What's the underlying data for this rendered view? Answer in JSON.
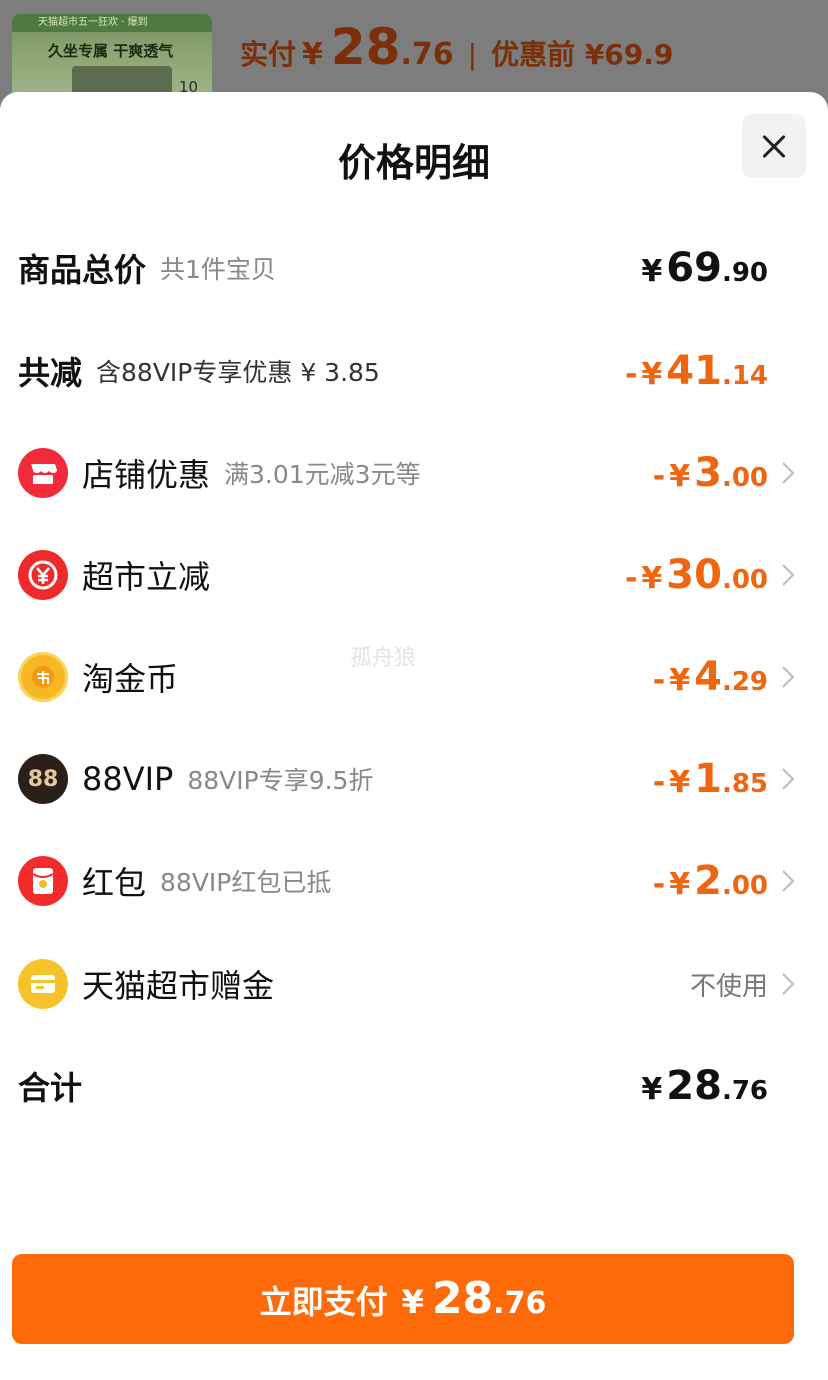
{
  "background": {
    "thumb_strip": "天猫超市五一狂欢 · 爆到",
    "thumb_title": "久坐专属  干爽透气",
    "thumb_number": "10",
    "paid_label": "实付",
    "paid_yen": "¥",
    "paid_int": "28",
    "paid_dec": ".76",
    "separator": "|",
    "before_discount": "优惠前 ¥69.9"
  },
  "sheet": {
    "title": "价格明细",
    "close_icon": "close-icon"
  },
  "rows": {
    "total_goods": {
      "label": "商品总价",
      "sub": "共1件宝贝",
      "yen": "¥",
      "int": "69",
      "dec": ".90"
    },
    "total_reduction": {
      "label": "共减",
      "sub": "含88VIP专享优惠 ¥ 3.85",
      "prefix": "-",
      "yen": "¥",
      "int": "41",
      "dec": ".14"
    },
    "store_discount": {
      "icon": "store-icon",
      "label": "店铺优惠",
      "sub": "满3.01元减3元等",
      "prefix": "-",
      "yen": "¥",
      "int": "3",
      "dec": ".00"
    },
    "supermarket_cut": {
      "icon": "yuan-coin-icon",
      "label": "超市立减",
      "sub": "",
      "prefix": "-",
      "yen": "¥",
      "int": "30",
      "dec": ".00"
    },
    "tao_coin": {
      "icon": "tao-coin-icon",
      "label": "淘金币",
      "sub": "",
      "prefix": "-",
      "yen": "¥",
      "int": "4",
      "dec": ".29"
    },
    "vip88": {
      "icon": "88vip-icon",
      "icon_text": "88",
      "label": "88VIP",
      "sub": "88VIP专享9.5折",
      "prefix": "-",
      "yen": "¥",
      "int": "1",
      "dec": ".85"
    },
    "red_packet": {
      "icon": "red-packet-icon",
      "label": "红包",
      "sub": "88VIP红包已抵",
      "prefix": "-",
      "yen": "¥",
      "int": "2",
      "dec": ".00"
    },
    "gift_money": {
      "icon": "gift-card-icon",
      "label": "天猫超市赠金",
      "value": "不使用"
    },
    "grand_total": {
      "label": "合计",
      "yen": "¥",
      "int": "28",
      "dec": ".76"
    }
  },
  "watermark": "孤舟狼",
  "pay_button": {
    "label": "立即支付",
    "yen": "¥",
    "int": "28",
    "dec": ".76"
  },
  "colors": {
    "accent": "#ff6a08",
    "discount": "#f0650f"
  }
}
